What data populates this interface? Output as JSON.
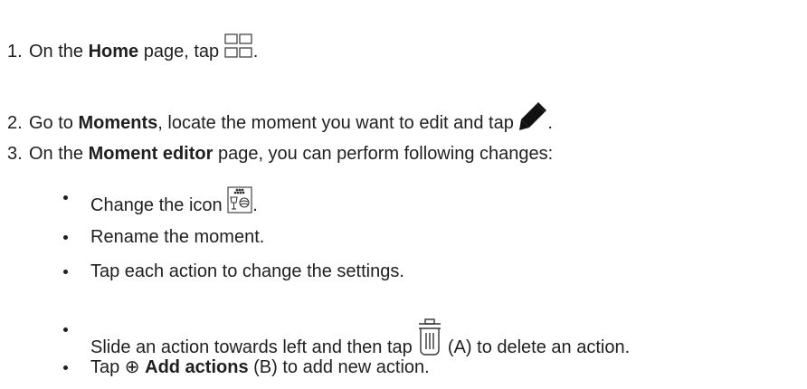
{
  "steps": [
    {
      "number": "1.",
      "before": "On the ",
      "bold": "Home",
      "after": " page, tap ",
      "icon": "grid-apps-icon",
      "end": "."
    },
    {
      "number": "2.",
      "before": "Go to ",
      "bold": "Moments",
      "after": ", locate the moment you want to edit and tap ",
      "icon": "pencil-edit-icon",
      "end": "."
    },
    {
      "number": "3.",
      "before": "On the ",
      "bold": "Moment editor",
      "after": " page, you can perform following changes:"
    }
  ],
  "bullets": [
    {
      "text": "Change the icon ",
      "icon": "moment-icon",
      "end": "."
    },
    {
      "text": "Rename the moment."
    },
    {
      "text": "Tap each action to change the settings."
    },
    {
      "before": "Slide an action towards left and then tap ",
      "icon": "trash-icon",
      "after": " (A) to delete an action."
    },
    {
      "before": "Tap ⊕ ",
      "bold": "Add actions",
      "after": " (B) to add new action."
    }
  ]
}
